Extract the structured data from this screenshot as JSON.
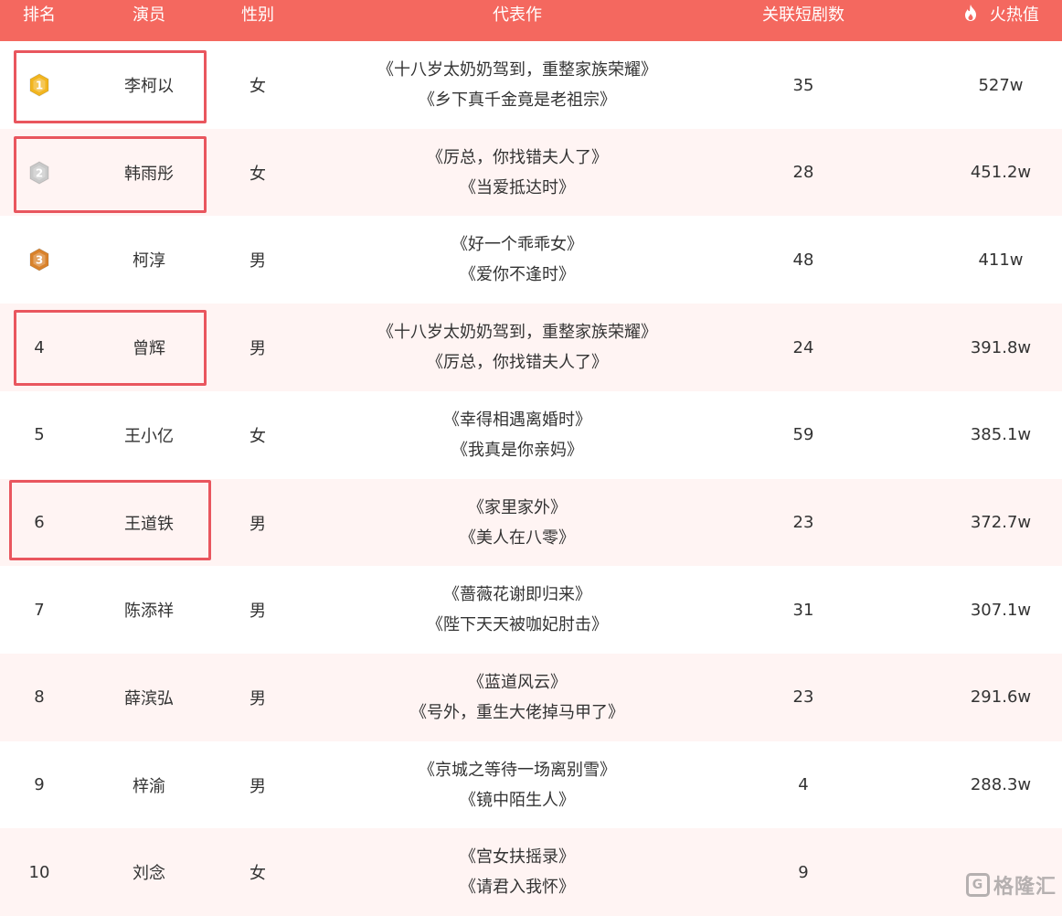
{
  "header": {
    "rank": "排名",
    "actor": "演员",
    "gender": "性别",
    "works": "代表作",
    "count": "关联短剧数",
    "heat": "火热值",
    "heat_icon": "fire-icon"
  },
  "colors": {
    "header_bg": "#f4685f",
    "row_alt_bg": "#fff4f3",
    "highlight_border": "#e9565e",
    "gold_medal": "#f2b51e",
    "silver_medal": "#c9c9c9",
    "bronze_medal": "#d9822b"
  },
  "rows": [
    {
      "rank": "1",
      "medal": "gold-medal-icon",
      "actor": "李柯以",
      "gender": "女",
      "work1": "《十八岁太奶奶驾到，重整家族荣耀》",
      "work2": "《乡下真千金竟是老祖宗》",
      "count": "35",
      "heat": "527w",
      "highlighted": true
    },
    {
      "rank": "2",
      "medal": "silver-medal-icon",
      "actor": "韩雨彤",
      "gender": "女",
      "work1": "《厉总，你找错夫人了》",
      "work2": "《当爱抵达时》",
      "count": "28",
      "heat": "451.2w",
      "highlighted": true
    },
    {
      "rank": "3",
      "medal": "bronze-medal-icon",
      "actor": "柯淳",
      "gender": "男",
      "work1": "《好一个乖乖女》",
      "work2": "《爱你不逢时》",
      "count": "48",
      "heat": "411w",
      "highlighted": false
    },
    {
      "rank": "4",
      "medal": "",
      "actor": "曾辉",
      "gender": "男",
      "work1": "《十八岁太奶奶驾到，重整家族荣耀》",
      "work2": "《厉总，你找错夫人了》",
      "count": "24",
      "heat": "391.8w",
      "highlighted": true
    },
    {
      "rank": "5",
      "medal": "",
      "actor": "王小亿",
      "gender": "女",
      "work1": "《幸得相遇离婚时》",
      "work2": "《我真是你亲妈》",
      "count": "59",
      "heat": "385.1w",
      "highlighted": false
    },
    {
      "rank": "6",
      "medal": "",
      "actor": "王道铁",
      "gender": "男",
      "work1": "《家里家外》",
      "work2": "《美人在八零》",
      "count": "23",
      "heat": "372.7w",
      "highlighted": true
    },
    {
      "rank": "7",
      "medal": "",
      "actor": "陈添祥",
      "gender": "男",
      "work1": "《蔷薇花谢即归来》",
      "work2": "《陛下天天被咖妃肘击》",
      "count": "31",
      "heat": "307.1w",
      "highlighted": false
    },
    {
      "rank": "8",
      "medal": "",
      "actor": "薛滨弘",
      "gender": "男",
      "work1": "《蓝道风云》",
      "work2": "《号外，重生大佬掉马甲了》",
      "count": "23",
      "heat": "291.6w",
      "highlighted": false
    },
    {
      "rank": "9",
      "medal": "",
      "actor": "梓渝",
      "gender": "男",
      "work1": "《京城之等待一场离别雪》",
      "work2": "《镜中陌生人》",
      "count": "4",
      "heat": "288.3w",
      "highlighted": false
    },
    {
      "rank": "10",
      "medal": "",
      "actor": "刘念",
      "gender": "女",
      "work1": "《宫女扶摇录》",
      "work2": "《请君入我怀》",
      "count": "9",
      "heat": "",
      "highlighted": false
    }
  ],
  "watermark": {
    "logo": "G",
    "text": "格隆汇"
  }
}
